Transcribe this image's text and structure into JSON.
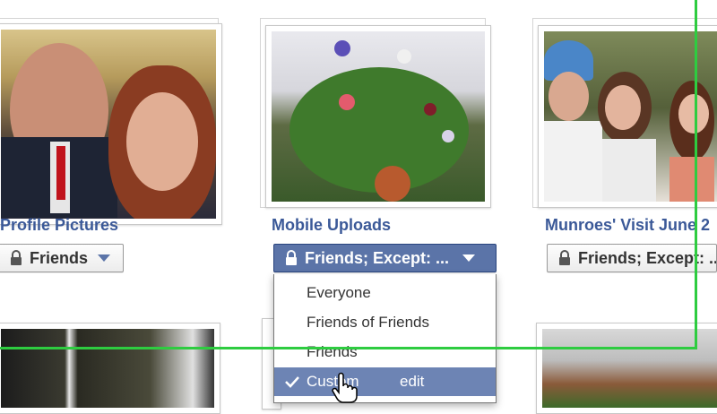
{
  "albums": [
    {
      "title": "Profile Pictures",
      "privacy": "Friends"
    },
    {
      "title": "Mobile Uploads",
      "privacy": "Friends; Except: ..."
    },
    {
      "title": "Munroes' Visit June 2",
      "privacy": "Friends; Except: ..."
    }
  ],
  "privacy_menu": {
    "options": [
      "Everyone",
      "Friends of Friends",
      "Friends"
    ],
    "selected": "Custom",
    "edit_label": "edit"
  },
  "icons": {
    "lock": "lock-icon",
    "caret": "caret-down-icon",
    "check": "check-icon",
    "cursor": "hand-cursor-icon"
  },
  "colors": {
    "link_blue": "#3b5998",
    "active_button": "#5b74a8",
    "selected_item": "#6d84b4",
    "frame_green": "#2ecc40"
  }
}
